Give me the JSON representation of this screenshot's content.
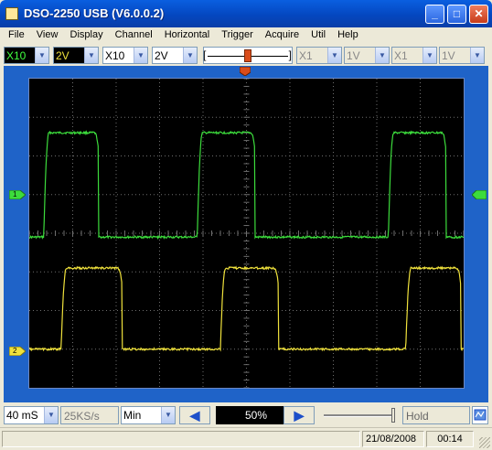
{
  "window": {
    "title": "DSO-2250 USB (V6.0.0.2)",
    "minimize_glyph": "_",
    "maximize_glyph": "□",
    "close_glyph": "✕"
  },
  "menu": [
    "File",
    "View",
    "Display",
    "Channel",
    "Horizontal",
    "Trigger",
    "Acquire",
    "Util",
    "Help"
  ],
  "toolbar": {
    "ch1_probe": "X10",
    "ch1_volts": "2V",
    "ch2_probe": "X10",
    "ch2_volts": "2V",
    "math_probe": "X1",
    "math_volts": "1V",
    "ref_probe": "X1",
    "ref_volts": "1V",
    "trigger_bracket_left": "[",
    "trigger_bracket_right": "]"
  },
  "scope": {
    "ch1_marker": "1",
    "ch2_marker": "2",
    "ch1_color": "#3cdc3c",
    "ch2_color": "#f0e23c",
    "grid_color": "#6e6e6e",
    "trigger_marker_color": "#d94c1a",
    "ch1_trace": {
      "high": 2.6,
      "low": -0.1,
      "edges": [
        0.5,
        2.4,
        5.8,
        7.8,
        12.4,
        14.4
      ]
    },
    "ch2_trace": {
      "high": -0.9,
      "low": -3.0,
      "edges": [
        1.1,
        3.2,
        6.6,
        8.6,
        13.0,
        14.9
      ]
    }
  },
  "bottom": {
    "timebase": "40 mS",
    "sample_rate": "25KS/s",
    "mode": "Min",
    "position_percent": "50%",
    "status": "Hold",
    "prev_glyph": "◀",
    "next_glyph": "▶"
  },
  "status_bar": {
    "date": "21/08/2008",
    "time": "00:14"
  }
}
